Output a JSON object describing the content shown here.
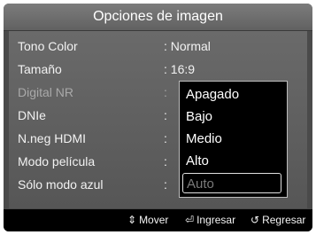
{
  "header": {
    "title": "Opciones de imagen"
  },
  "settings": [
    {
      "label": "Tono Color",
      "value": ": Normal",
      "disabled": false
    },
    {
      "label": "Tamaño",
      "value": ": 16:9",
      "disabled": false
    },
    {
      "label": "Digital NR",
      "value": ":",
      "disabled": true
    },
    {
      "label": "DNIe",
      "value": ":",
      "disabled": false
    },
    {
      "label": "N.neg HDMI",
      "value": ":",
      "disabled": false
    },
    {
      "label": "Modo película",
      "value": ":",
      "disabled": false
    },
    {
      "label": "Sólo modo azul",
      "value": ":",
      "disabled": false
    }
  ],
  "dropdown": {
    "options": [
      {
        "label": "Apagado",
        "disabled": false
      },
      {
        "label": "Bajo",
        "disabled": false
      },
      {
        "label": "Medio",
        "disabled": false
      },
      {
        "label": "Alto",
        "disabled": false
      },
      {
        "label": "Auto",
        "disabled": true
      }
    ]
  },
  "status": {
    "move_icon": "up-down-arrows-icon",
    "move_label": "Mover",
    "enter_icon": "enter-icon",
    "enter_label": "Ingresar",
    "return_icon": "return-icon",
    "return_label": "Regresar"
  },
  "colors": {
    "background": "#4a4a4a",
    "dropdown_bg": "#000000",
    "text": "#f2f2f2",
    "disabled_text": "#a9a9a9"
  }
}
